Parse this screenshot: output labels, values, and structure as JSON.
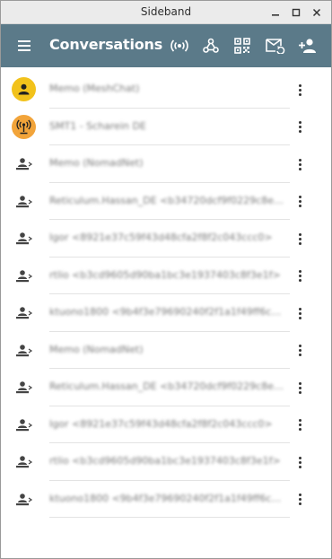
{
  "window": {
    "title": "Sideband"
  },
  "appbar": {
    "title": "Conversations",
    "background": "#5b7a89",
    "buttons": [
      "menu-icon",
      "announce-icon",
      "network-icon",
      "qr-code-icon",
      "mail-sync-icon",
      "add-contact-icon"
    ]
  },
  "conversations": [
    {
      "label": "Memo (MeshChat)",
      "icon": "person-avatar",
      "color": "#f2c21b"
    },
    {
      "label": "SMT1 - Scharein DE",
      "icon": "antenna-avatar",
      "color": "#f2a43a"
    },
    {
      "label": "Memo (NomadNet)",
      "icon": "peer-icon"
    },
    {
      "label": "Reticulum.Hassan_DE <b34720dcf9f0229c8e9c...",
      "icon": "peer-icon"
    },
    {
      "label": "Igor <8921e37c59f43d48cfa2f8f2c043ccc0>",
      "icon": "peer-icon"
    },
    {
      "label": "rtlio <b3cd9605d90ba1bc3e1937403c8f3e1f>",
      "icon": "peer-icon"
    },
    {
      "label": "ktuono1800 <9b4f3e79690240f2f1a1f49ff6ce65a...",
      "icon": "peer-icon"
    },
    {
      "label": "Memo (NomadNet)",
      "icon": "peer-icon"
    },
    {
      "label": "Reticulum.Hassan_DE <b34720dcf9f0229c8e9c...",
      "icon": "peer-icon"
    },
    {
      "label": "Igor <8921e37c59f43d48cfa2f8f2c043ccc0>",
      "icon": "peer-icon"
    },
    {
      "label": "rtlio <b3cd9605d90ba1bc3e1937403c8f3e1f>",
      "icon": "peer-icon"
    },
    {
      "label": "ktuono1800 <9b4f3e79690240f2f1a1f49ff6ce65a...",
      "icon": "peer-icon"
    }
  ]
}
